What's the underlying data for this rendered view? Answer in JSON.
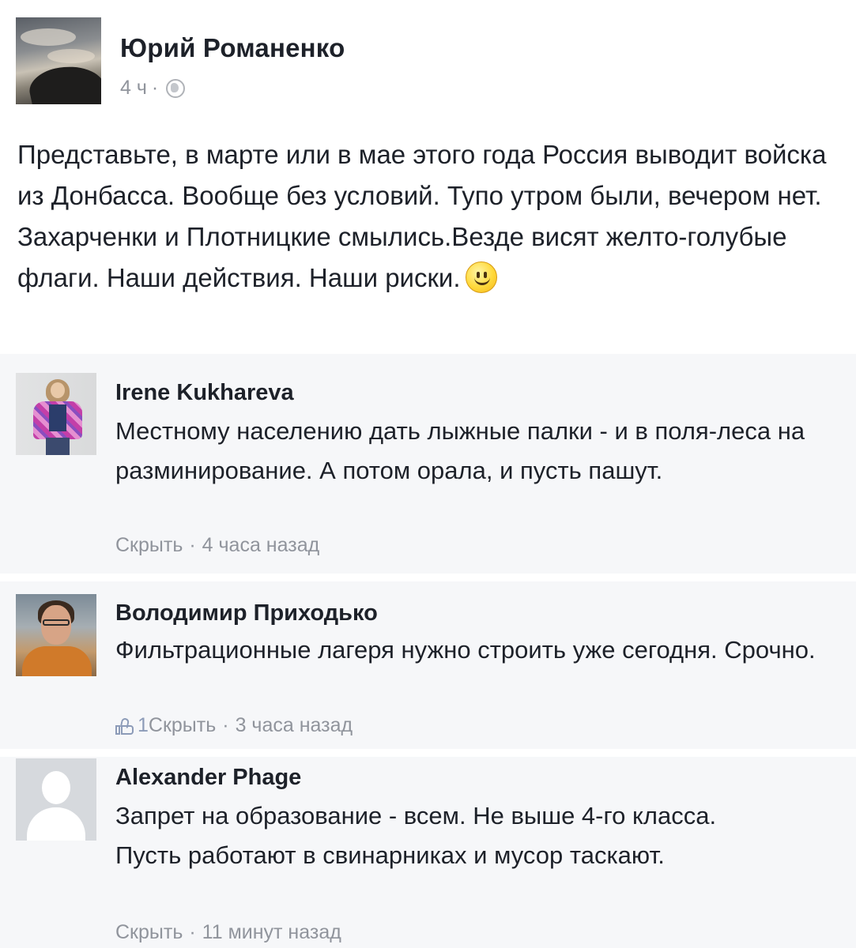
{
  "post": {
    "author": "Юрий Романенко",
    "time": "4 ч",
    "meta_sep": "·",
    "text": "Представьте, в марте или в мае этого года Россия выводит войска из Донбасса. Вообще без условий. Тупо утром были, вечером нет. Захарченки и Плотницкие смылись.Везде висят желто-голубые флаги. Наши действия. Наши риски.",
    "icons": [
      "globe-icon",
      "smiley-icon"
    ]
  },
  "comments": [
    {
      "name": "Irene Kukhareva",
      "text": "Местному населению дать лыжные палки - и в поля-леса на разминирование. А потом орала, и пусть пашут.",
      "action": "Скрыть",
      "time": "4 часа назад"
    },
    {
      "name": "Володимир Приходько",
      "text": "Фильтрационные лагеря нужно строить уже сегодня. Срочно.",
      "likes": "1",
      "action": "Скрыть",
      "time": "3 часа назад"
    },
    {
      "name": "Alexander Phage",
      "text_line1": "Запрет на образование - всем. Не выше 4-го класса.",
      "text_line2": "Пусть работают в свинарниках и мусор таскают.",
      "action": "Скрыть",
      "time": "11 минут назад"
    }
  ],
  "meta_sep": "·"
}
